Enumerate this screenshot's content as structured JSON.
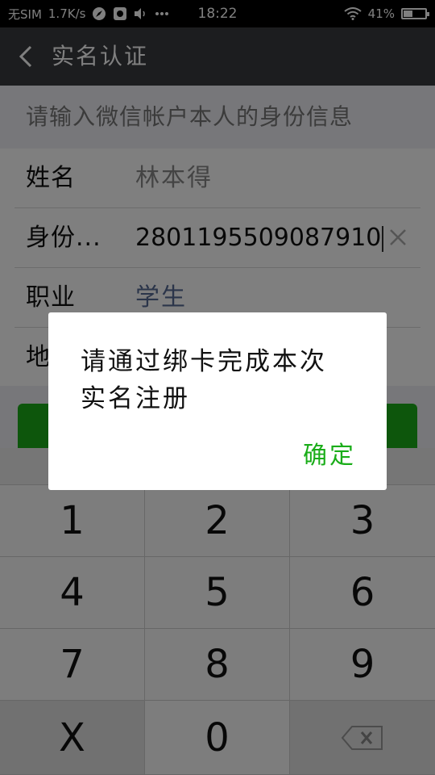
{
  "statusbar": {
    "carrier": "无SIM",
    "speed": "1.7K/s",
    "time": "18:22",
    "battery_percent": "41%",
    "battery_level": 0.41,
    "icons": [
      "compass-icon",
      "app-icon",
      "volume-icon",
      "more-dots-icon",
      "wifi-icon",
      "battery-icon"
    ]
  },
  "header": {
    "title": "实名认证",
    "back_icon": "chevron-left-icon"
  },
  "form": {
    "hint": "请输入微信帐户本人的身份信息",
    "rows": [
      {
        "label": "姓名",
        "value": "林本得"
      },
      {
        "label": "身份...",
        "value": "2801195509087910"
      },
      {
        "label": "职业",
        "value": "学生"
      },
      {
        "label": "地",
        "value": ""
      }
    ]
  },
  "keyboard": {
    "keys": [
      "1",
      "2",
      "3",
      "4",
      "5",
      "6",
      "7",
      "8",
      "9",
      "X",
      "0",
      ""
    ],
    "backspace_icon": "backspace-icon"
  },
  "dialog": {
    "message": "请通过绑卡完成本次实名注册",
    "ok_label": "确定"
  },
  "colors": {
    "accent_green": "#1aad19",
    "titlebar": "#393a3f",
    "link_blue": "#576b95"
  }
}
